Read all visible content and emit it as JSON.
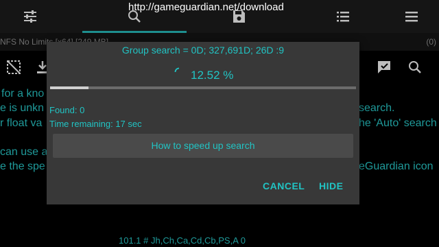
{
  "url_overlay": "http://gameguardian.net/download",
  "process": {
    "name": "NFS No Limits [x64] [249 MB]",
    "count": "(0)"
  },
  "icons": {
    "toolbar": [
      "sliders-icon",
      "search-icon",
      "save-icon",
      "list-icon",
      "menu-icon"
    ],
    "actions": [
      "selection-icon",
      "download-icon",
      "chat-icon",
      "search-icon"
    ]
  },
  "background_lines": [
    "for a kno",
    "e is unkn",
    "r float va",
    "can use a",
    "e the spe",
    "search.",
    "he 'Auto' search",
    "eGuardian icon"
  ],
  "bottom_text": "101.1 # Jh,Ch,Ca,Cd,Cb,PS,A 0",
  "dialog": {
    "title_main": "Group search = 0D; 327,691D; 26D ",
    "title_suffix": ":9",
    "percent_text": "12.52 %",
    "progress": 0.1252,
    "found": "Found: 0",
    "time_remaining": "Time remaining: 17 sec",
    "help_button": "How to speed up search",
    "cancel": "CANCEL",
    "hide": "HIDE"
  },
  "colors": {
    "accent": "#21c4c4",
    "toolbar_bg": "#151515",
    "dialog_bg": "#383838"
  }
}
